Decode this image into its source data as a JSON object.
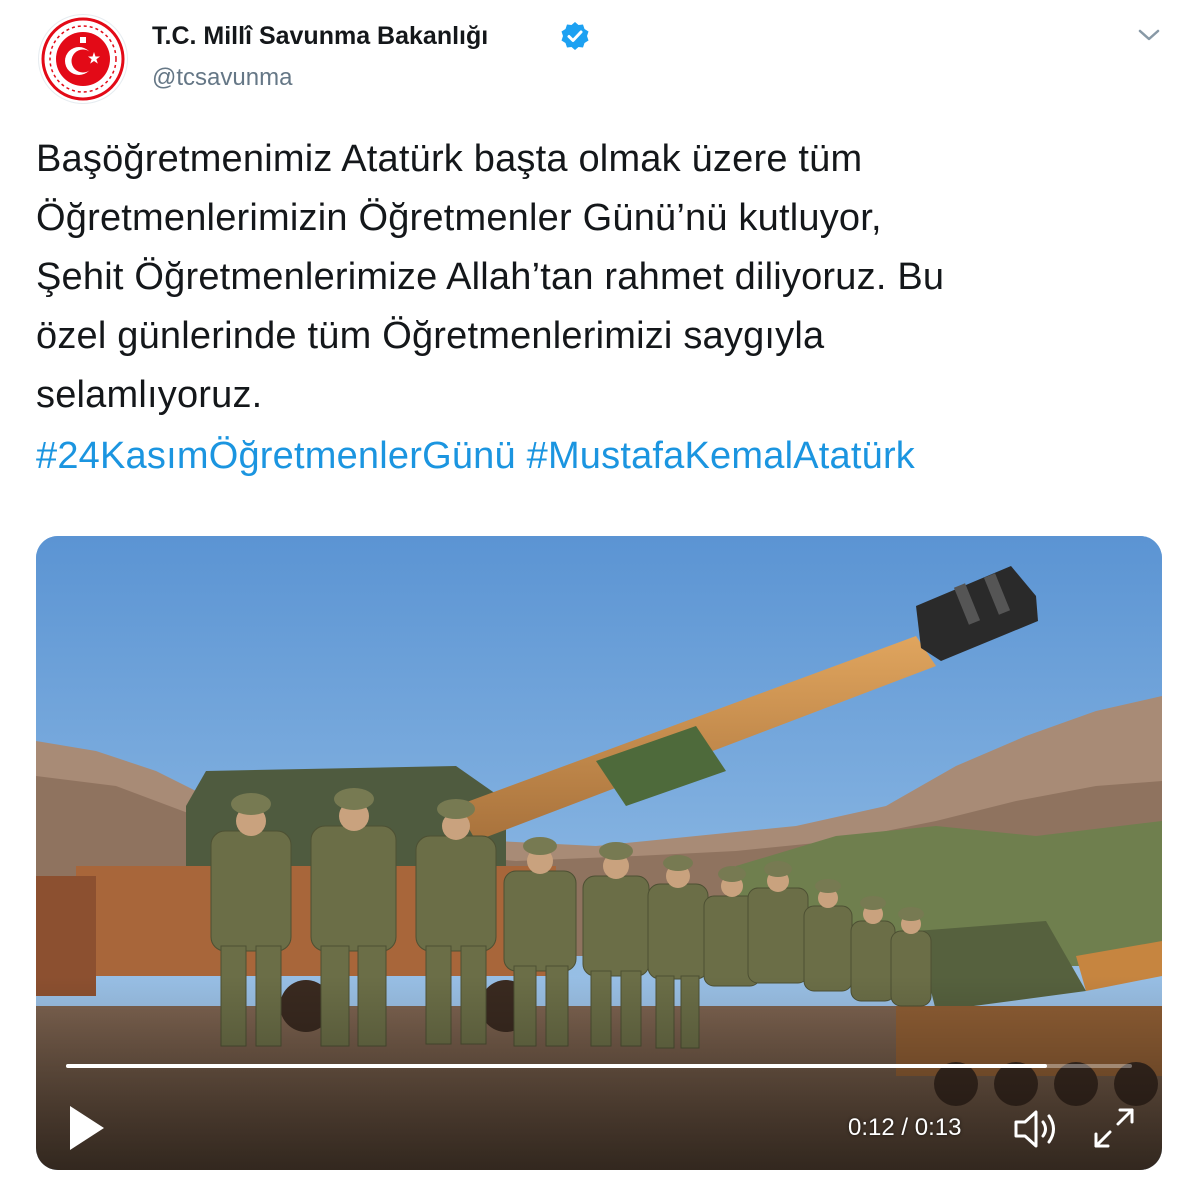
{
  "account": {
    "display_name": "T.C. Millî Savunma Bakanlığı",
    "handle": "@tcsavunma",
    "verified": true,
    "avatar_icon": "ministry-of-defense-crest",
    "menu_icon": "chevron-down-icon"
  },
  "tweet": {
    "text": "Başöğretmenimiz Atatürk başta olmak üzere tüm\nÖğretmenlerimizin Öğretmenler Günü’nü kutluyor,\nŞehit Öğretmenlerimize Allah’tan rahmet diliyoruz. Bu\nözel günlerinde tüm Öğretmenlerimizi saygıyla\nselamlıyoruz.",
    "hashtags": [
      "#24KasımÖğretmenlerGünü",
      "#MustafaKemalAtatürk"
    ]
  },
  "video": {
    "current_time": "0:12",
    "duration": "0:13",
    "time_display": "0:12 / 0:13",
    "progress": 0.92,
    "state": "paused"
  },
  "colors": {
    "name_text": "#14171a",
    "handle_text": "#657786",
    "hashtag": "#1b95e0",
    "verified_badge": "#1da1f2",
    "crest_red": "#e30a17"
  }
}
